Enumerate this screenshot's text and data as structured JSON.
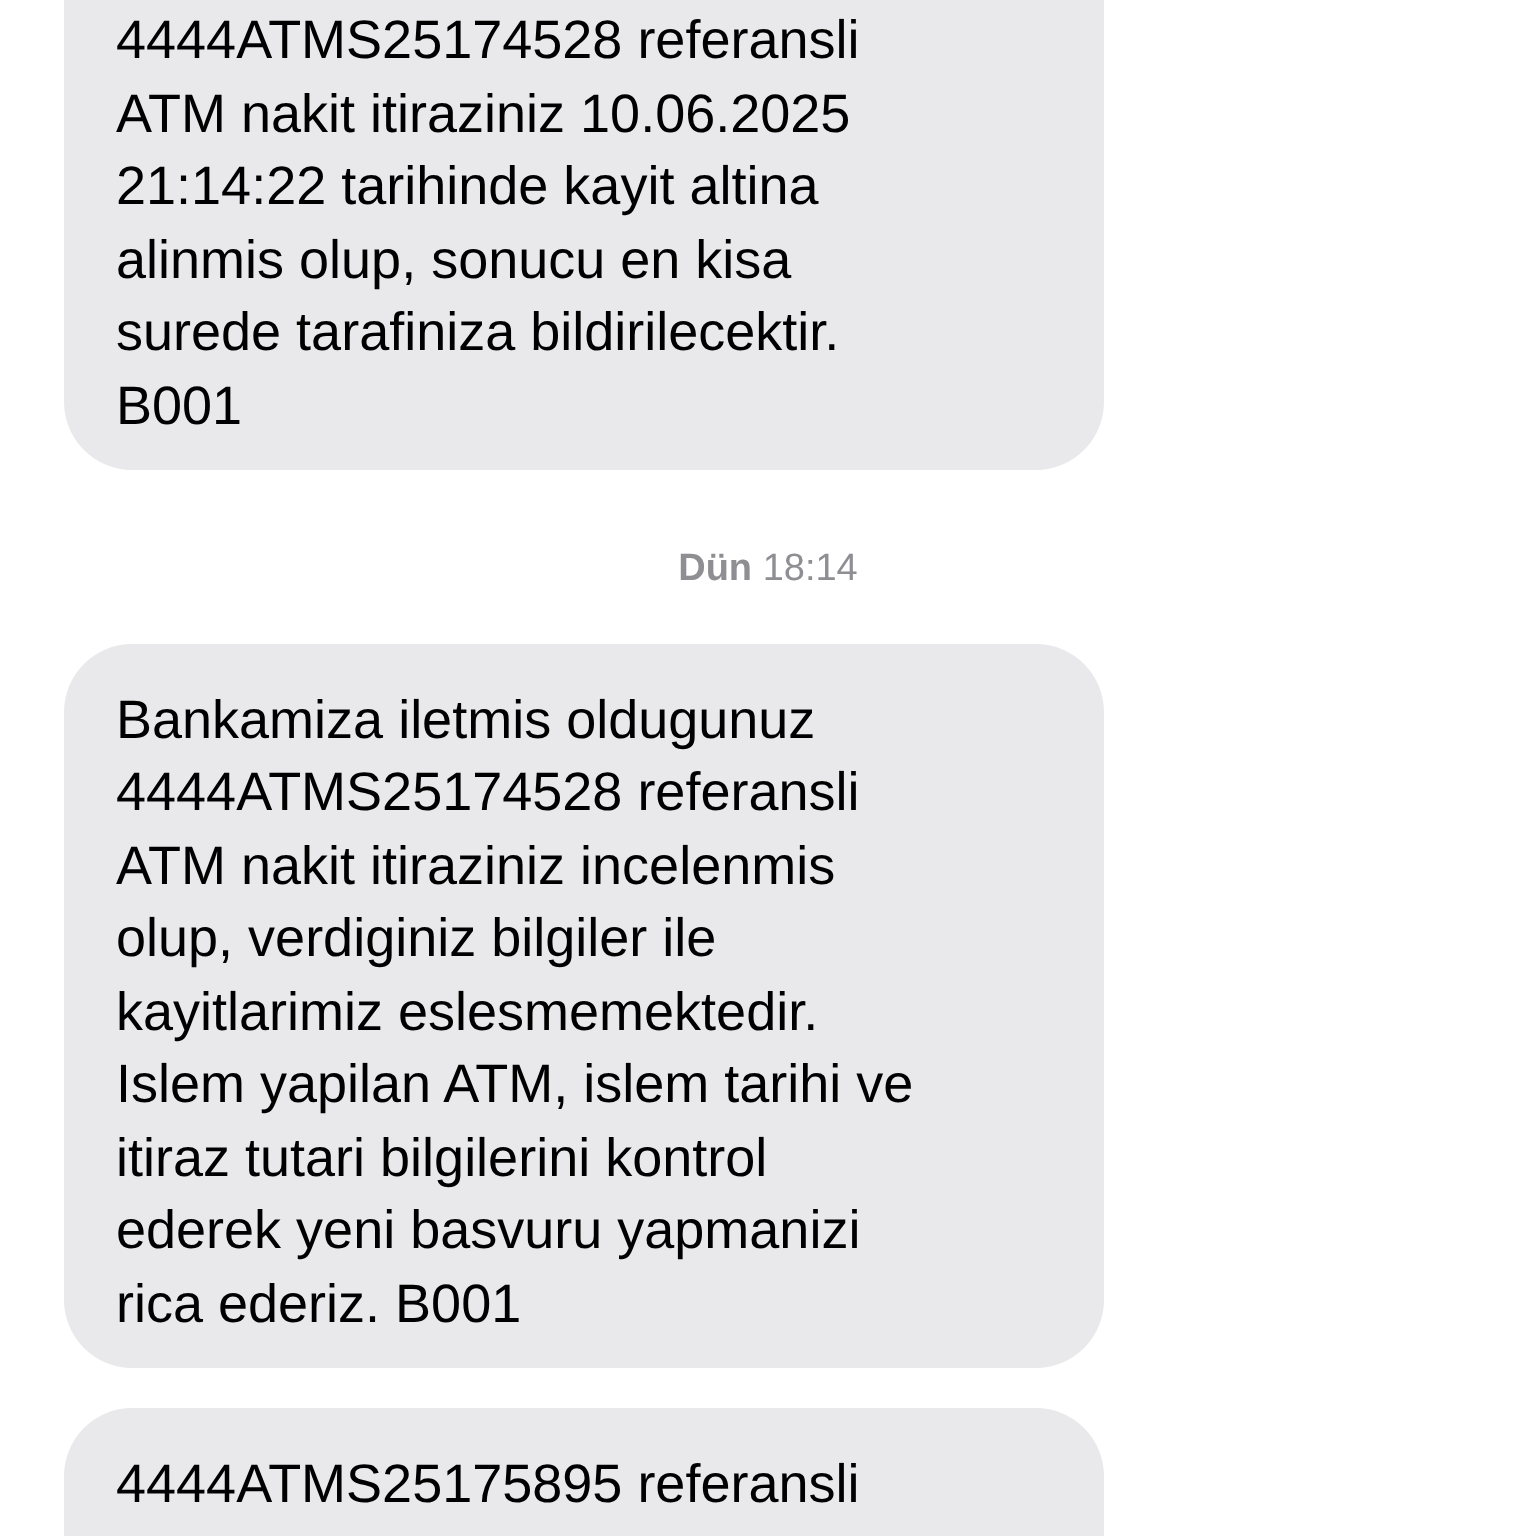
{
  "messages": [
    {
      "kind": "bubble",
      "lines": [
        "4444ATMS25174528 referansli",
        "ATM nakit itiraziniz 10.06.2025",
        "21:14:22 tarihinde kayit altina",
        "alinmis olup, sonucu en kisa",
        "surede tarafiniza bildirilecektir.",
        "B001"
      ]
    },
    {
      "kind": "time",
      "text": "**Dün** 18:14"
    },
    {
      "kind": "bubble",
      "lines": [
        "Bankamiza iletmis oldugunuz",
        "4444ATMS25174528 referansli",
        "ATM nakit itiraziniz incelenmis",
        "olup, verdiginiz bilgiler ile",
        "kayitlarimiz eslesmemektedir.",
        "Islem yapilan ATM, islem tarihi ve",
        "itiraz tutari bilgilerini kontrol",
        "ederek yeni basvuru yapmanizi",
        "rica ederiz. B001"
      ]
    },
    {
      "kind": "bubble",
      "lines": [
        "4444ATMS25175895 referansli"
      ]
    }
  ]
}
